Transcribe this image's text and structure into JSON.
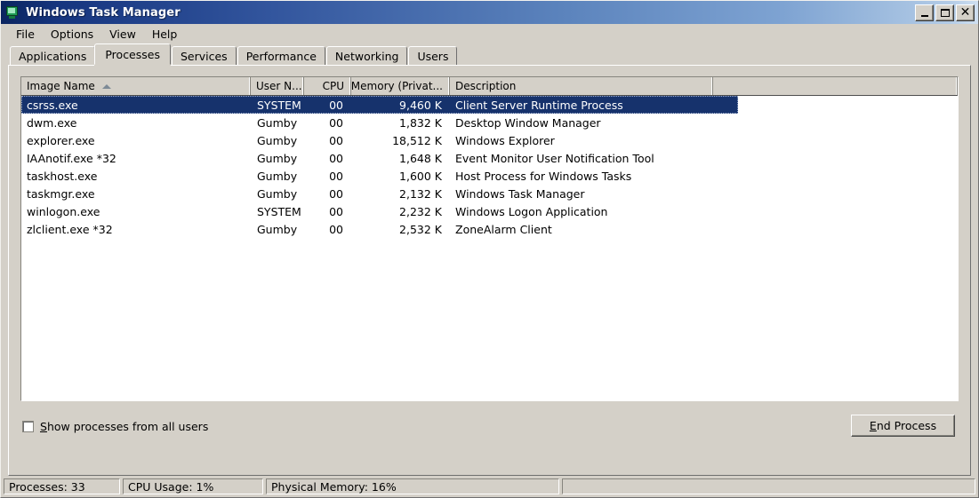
{
  "window": {
    "title": "Windows Task Manager",
    "icon": "task-manager-monitor-icon",
    "controls": {
      "minimize": "_",
      "maximize": "□",
      "close": "✕"
    }
  },
  "menu": {
    "items": [
      {
        "label": "File"
      },
      {
        "label": "Options"
      },
      {
        "label": "View"
      },
      {
        "label": "Help"
      }
    ]
  },
  "tabs": {
    "active": "Processes",
    "items": [
      {
        "label": "Applications"
      },
      {
        "label": "Processes"
      },
      {
        "label": "Services"
      },
      {
        "label": "Performance"
      },
      {
        "label": "Networking"
      },
      {
        "label": "Users"
      }
    ]
  },
  "process_list": {
    "sort_column": "Image Name",
    "sort_direction": "ascending",
    "columns": [
      {
        "label": "Image Name",
        "align": "left"
      },
      {
        "label": "User N...",
        "align": "left"
      },
      {
        "label": "CPU",
        "align": "right"
      },
      {
        "label": "Memory (Privat...",
        "align": "right"
      },
      {
        "label": "Description",
        "align": "left"
      }
    ],
    "selected_index": 0,
    "rows": [
      {
        "image_name": "csrss.exe",
        "user_name": "SYSTEM",
        "cpu": "00",
        "memory": "9,460 K",
        "description": "Client Server Runtime Process"
      },
      {
        "image_name": "dwm.exe",
        "user_name": "Gumby",
        "cpu": "00",
        "memory": "1,832 K",
        "description": "Desktop Window Manager"
      },
      {
        "image_name": "explorer.exe",
        "user_name": "Gumby",
        "cpu": "00",
        "memory": "18,512 K",
        "description": "Windows Explorer"
      },
      {
        "image_name": "IAAnotif.exe *32",
        "user_name": "Gumby",
        "cpu": "00",
        "memory": "1,648 K",
        "description": "Event Monitor User Notification Tool"
      },
      {
        "image_name": "taskhost.exe",
        "user_name": "Gumby",
        "cpu": "00",
        "memory": "1,600 K",
        "description": "Host Process for Windows Tasks"
      },
      {
        "image_name": "taskmgr.exe",
        "user_name": "Gumby",
        "cpu": "00",
        "memory": "2,132 K",
        "description": "Windows Task Manager"
      },
      {
        "image_name": "winlogon.exe",
        "user_name": "SYSTEM",
        "cpu": "00",
        "memory": "2,232 K",
        "description": "Windows Logon Application"
      },
      {
        "image_name": "zlclient.exe *32",
        "user_name": "Gumby",
        "cpu": "00",
        "memory": "2,532 K",
        "description": "ZoneAlarm Client"
      }
    ]
  },
  "footer": {
    "show_all_users_checkbox": {
      "label_accel": "S",
      "label_rest": "how processes from all users",
      "checked": false
    },
    "end_process_button": {
      "label_accel": "E",
      "label_rest": "nd Process"
    }
  },
  "statusbar": {
    "processes": "Processes: 33",
    "cpu_usage": "CPU Usage: 1%",
    "physical_memory": "Physical Memory: 16%"
  },
  "colors": {
    "selection": "#16326c",
    "face": "#d4d0c8",
    "title_left": "#0b2560",
    "title_right": "#cfdff0"
  }
}
